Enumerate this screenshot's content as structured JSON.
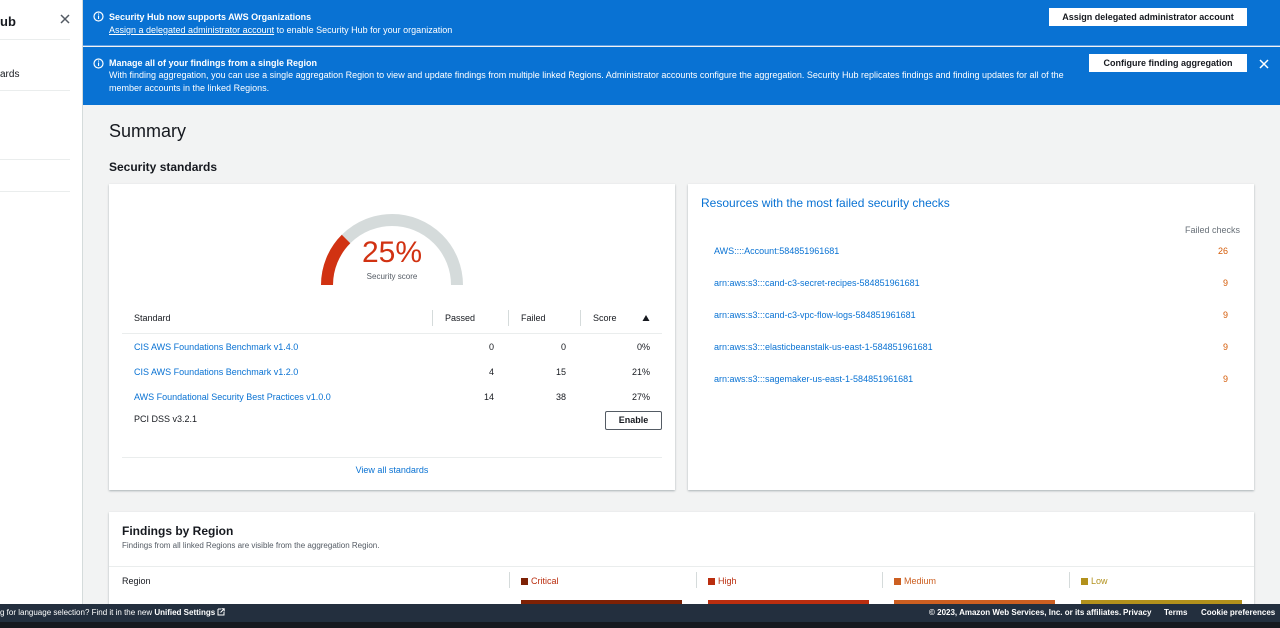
{
  "sidebar": {
    "title_fragment": "ub",
    "item_fragment": "ards"
  },
  "banner_orgs": {
    "title": "Security Hub now supports AWS Organizations",
    "link_text": "Assign a delegated administrator account",
    "text_after_link": " to enable Security Hub for your organization",
    "button_label": "Assign delegated administrator account"
  },
  "banner_agg": {
    "title": "Manage all of your findings from a single Region",
    "text": "With finding aggregation, you can use a single aggregation Region to view and update findings from multiple linked Regions. Administrator accounts configure the aggregation. Security Hub replicates findings and finding updates for all of the member accounts in the linked Regions.",
    "button_label": "Configure finding aggregation"
  },
  "page": {
    "title": "Summary",
    "section_title": "Security standards"
  },
  "score": {
    "value_text": "25%",
    "value_fraction": 0.25,
    "label": "Security score",
    "color": "#d13212"
  },
  "standards_table": {
    "headers": {
      "standard": "Standard",
      "passed": "Passed",
      "failed": "Failed",
      "score": "Score"
    },
    "rows": [
      {
        "name": "CIS AWS Foundations Benchmark v1.4.0",
        "passed": "0",
        "failed": "0",
        "score": "0%"
      },
      {
        "name": "CIS AWS Foundations Benchmark v1.2.0",
        "passed": "4",
        "failed": "15",
        "score": "21%"
      },
      {
        "name": "AWS Foundational Security Best Practices v1.0.0",
        "passed": "14",
        "failed": "38",
        "score": "27%"
      },
      {
        "name": "PCI DSS v3.2.1",
        "enable_label": "Enable"
      }
    ],
    "view_all": "View all standards"
  },
  "resources": {
    "title": "Resources with the most failed security checks",
    "column_header": "Failed checks",
    "rows": [
      {
        "name": "AWS::::Account:584851961681",
        "count": "26"
      },
      {
        "name": "arn:aws:s3:::cand-c3-secret-recipes-584851961681",
        "count": "9"
      },
      {
        "name": "arn:aws:s3:::cand-c3-vpc-flow-logs-584851961681",
        "count": "9"
      },
      {
        "name": "arn:aws:s3:::elasticbeanstalk-us-east-1-584851961681",
        "count": "9"
      },
      {
        "name": "arn:aws:s3:::sagemaker-us-east-1-584851961681",
        "count": "9"
      }
    ]
  },
  "findings": {
    "title": "Findings by Region",
    "subtitle": "Findings from all linked Regions are visible from the aggregation Region.",
    "headers": {
      "region": "Region",
      "critical": "Critical",
      "high": "High",
      "medium": "Medium",
      "low": "Low"
    },
    "colors": {
      "critical": "#7d2105",
      "high": "#ba2e0f",
      "medium": "#cc5f21",
      "low": "#b2911c"
    }
  },
  "footer": {
    "left_text": "g for language selection? Find it in the new ",
    "left_link": "Unified Settings",
    "copyright": "© 2023, Amazon Web Services, Inc. or its affiliates.",
    "privacy": "Privacy",
    "terms": "Terms",
    "cookies": "Cookie preferences"
  }
}
